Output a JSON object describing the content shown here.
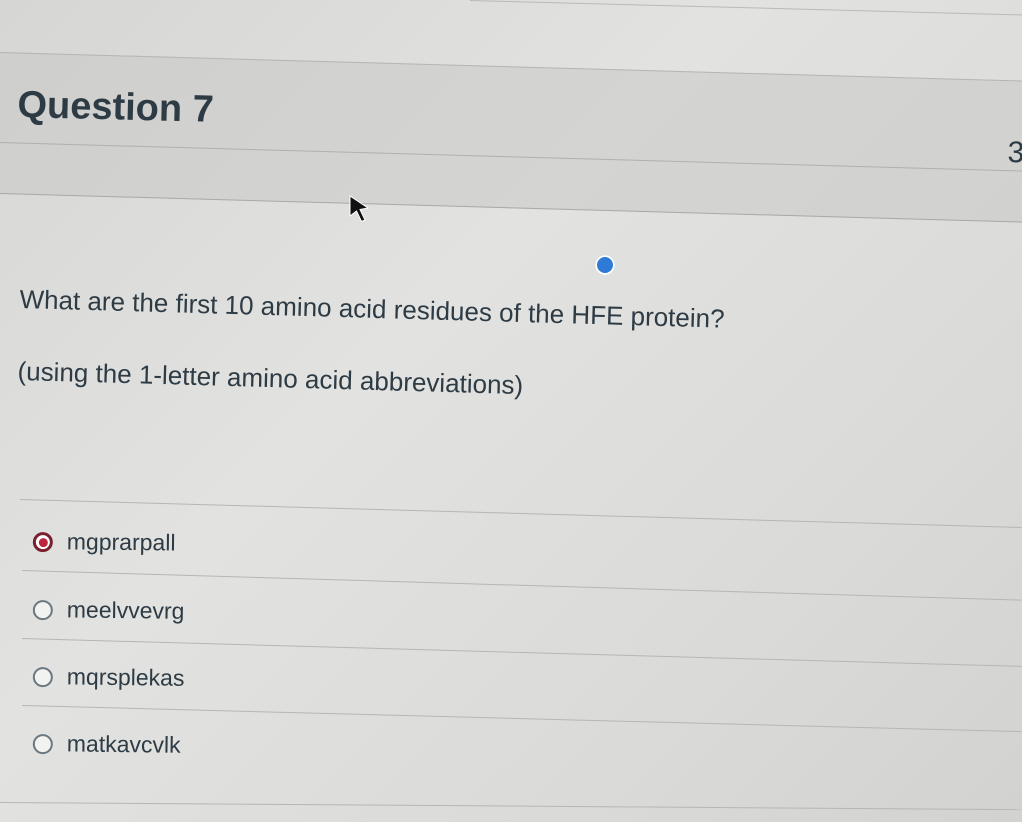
{
  "question": {
    "title": "Question 7",
    "points_fragment": "3",
    "text": "What are the first 10 amino acid residues of the HFE protein?",
    "subtext": "(using the 1-letter amino acid abbreviations)"
  },
  "answers": [
    {
      "label": "mgprarpall",
      "selected": true
    },
    {
      "label": "meelvvevrg",
      "selected": false
    },
    {
      "label": "mqrsplekas",
      "selected": false
    },
    {
      "label": "matkavcvlk",
      "selected": false
    }
  ],
  "colors": {
    "text": "#2d3b45",
    "selected_radio": "#c0233f",
    "indicator_dot": "#2f7ad6"
  }
}
